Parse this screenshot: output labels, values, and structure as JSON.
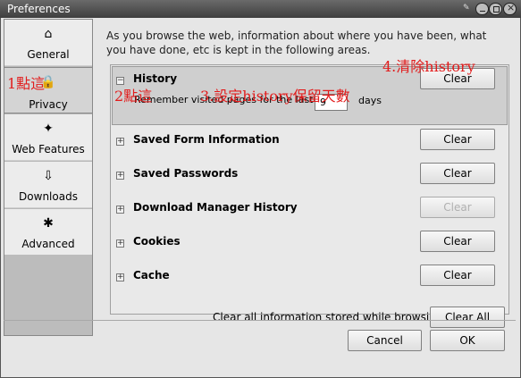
{
  "window": {
    "title": "Preferences"
  },
  "sidebar": {
    "items": [
      {
        "label": "General",
        "icon": "home-icon",
        "glyph": "⌂"
      },
      {
        "label": "Privacy",
        "icon": "lock-icon",
        "glyph": "🔒"
      },
      {
        "label": "Web Features",
        "icon": "puzzle-icon",
        "glyph": "✦"
      },
      {
        "label": "Downloads",
        "icon": "download-icon",
        "glyph": "⇩"
      },
      {
        "label": "Advanced",
        "icon": "gear-icon",
        "glyph": "✱"
      }
    ]
  },
  "privacy": {
    "intro": "As you browse the web, information about where you have been, what you have done, etc is kept in the following areas.",
    "history": {
      "title": "History",
      "remember_prefix": "Remember visited pages for the last",
      "days_value": "9",
      "days_suffix": "days",
      "clear_label": "Clear"
    },
    "rows": [
      {
        "label": "Saved Form Information",
        "clear_label": "Clear",
        "disabled": false
      },
      {
        "label": "Saved Passwords",
        "clear_label": "Clear",
        "disabled": false
      },
      {
        "label": "Download Manager History",
        "clear_label": "Clear",
        "disabled": true
      },
      {
        "label": "Cookies",
        "clear_label": "Clear",
        "disabled": false
      },
      {
        "label": "Cache",
        "clear_label": "Clear",
        "disabled": false
      }
    ],
    "clear_all_text": "Clear all information stored while browsing:",
    "clear_all_label": "Clear All"
  },
  "dialog": {
    "cancel_label": "Cancel",
    "ok_label": "OK"
  },
  "annotations": {
    "step1": "1點這",
    "step2": "2點這",
    "step3": "3.設定history保留天數",
    "step4": "4.清除history"
  },
  "colors": {
    "annotation": "#e21c1c",
    "titlebar": "#4a4a4a",
    "selected_sidebar": "#d4d4d4"
  }
}
